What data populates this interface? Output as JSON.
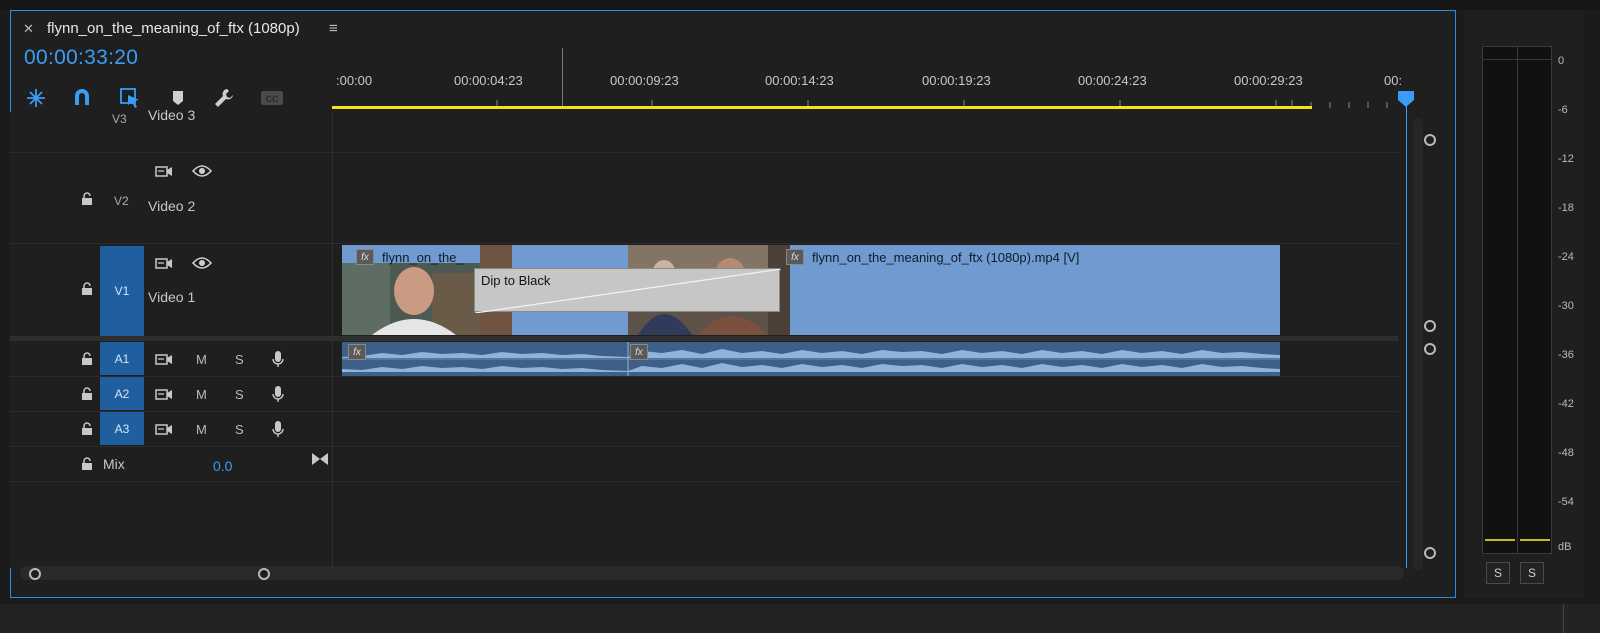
{
  "tab": {
    "title": "flynn_on_the_meaning_of_ftx (1080p)"
  },
  "timecode": "00:00:33:20",
  "ruler": {
    "labels": [
      ":00:00",
      "00:00:04:23",
      "00:00:09:23",
      "00:00:14:23",
      "00:00:19:23",
      "00:00:24:23",
      "00:00:29:23",
      "00:"
    ]
  },
  "tracks": {
    "v3": {
      "id": "V3",
      "name": "Video 3"
    },
    "v2": {
      "id": "V2",
      "name": "Video 2"
    },
    "v1": {
      "id": "V1",
      "name": "Video 1"
    },
    "a1": {
      "id": "A1",
      "m": "M",
      "s": "S"
    },
    "a2": {
      "id": "A2",
      "m": "M",
      "s": "S"
    },
    "a3": {
      "id": "A3",
      "m": "M",
      "s": "S"
    },
    "mix": {
      "name": "Mix",
      "value": "0.0"
    }
  },
  "clips": {
    "v1_left_name": "flynn_on_the_",
    "v1_right_name": "flynn_on_the_meaning_of_ftx (1080p).mp4 [V]",
    "transition": "Dip to Black",
    "fx": "fx"
  },
  "meter": {
    "db_labels": [
      "0",
      "-6",
      "-12",
      "-18",
      "-24",
      "-30",
      "-36",
      "-42",
      "-48",
      "-54",
      "dB"
    ],
    "solo_left": "S",
    "solo_right": "S"
  },
  "colors": {
    "accent": "#2d8ceb",
    "timecode": "#3a9cf5",
    "work_area": "#f2e21a",
    "video_clip": "#6f9bd1",
    "audio_clip": "#3d5f88",
    "track_target": "#1f5fa0"
  }
}
